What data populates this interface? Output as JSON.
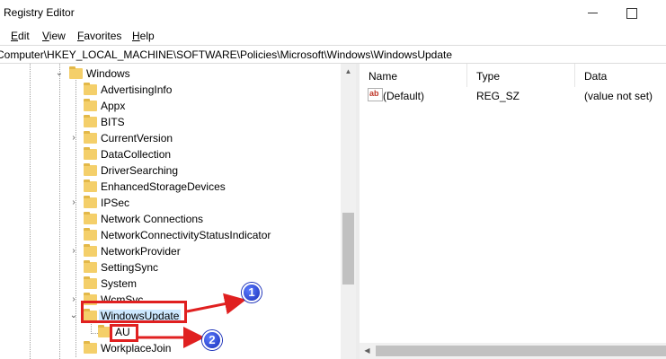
{
  "window": {
    "title": "Registry Editor"
  },
  "menu": [
    {
      "label": "Edit",
      "underline": "E",
      "rest": "dit"
    },
    {
      "label": "View",
      "underline": "V",
      "rest": "iew"
    },
    {
      "label": "Favorites",
      "underline": "F",
      "rest": "avorites"
    },
    {
      "label": "Help",
      "underline": "H",
      "rest": "elp"
    }
  ],
  "address": {
    "path": "Computer\\HKEY_LOCAL_MACHINE\\SOFTWARE\\Policies\\Microsoft\\Windows\\WindowsUpdate"
  },
  "tree": {
    "parent": "Windows",
    "items": [
      {
        "label": "AdvertisingInfo",
        "expandable": false
      },
      {
        "label": "Appx",
        "expandable": false
      },
      {
        "label": "BITS",
        "expandable": false
      },
      {
        "label": "CurrentVersion",
        "expandable": true
      },
      {
        "label": "DataCollection",
        "expandable": false
      },
      {
        "label": "DriverSearching",
        "expandable": false
      },
      {
        "label": "EnhancedStorageDevices",
        "expandable": false
      },
      {
        "label": "IPSec",
        "expandable": true
      },
      {
        "label": "Network Connections",
        "expandable": false
      },
      {
        "label": "NetworkConnectivityStatusIndicator",
        "expandable": false
      },
      {
        "label": "NetworkProvider",
        "expandable": true
      },
      {
        "label": "SettingSync",
        "expandable": false
      },
      {
        "label": "System",
        "expandable": false
      },
      {
        "label": "WcmSvc",
        "expandable": true
      },
      {
        "label": "WindowsUpdate",
        "expandable": true,
        "expanded": true,
        "selected": true
      },
      {
        "label": "AU",
        "expandable": false,
        "child": true
      },
      {
        "label": "WorkplaceJoin",
        "expandable": false
      }
    ]
  },
  "values": {
    "columns": [
      "Name",
      "Type",
      "Data"
    ],
    "rows": [
      {
        "name": "(Default)",
        "type": "REG_SZ",
        "data": "(value not set)",
        "icon": "string-value-icon"
      }
    ]
  },
  "annotations": [
    {
      "number": "1",
      "color": "#e02020"
    },
    {
      "number": "2",
      "color": "#e02020"
    }
  ]
}
